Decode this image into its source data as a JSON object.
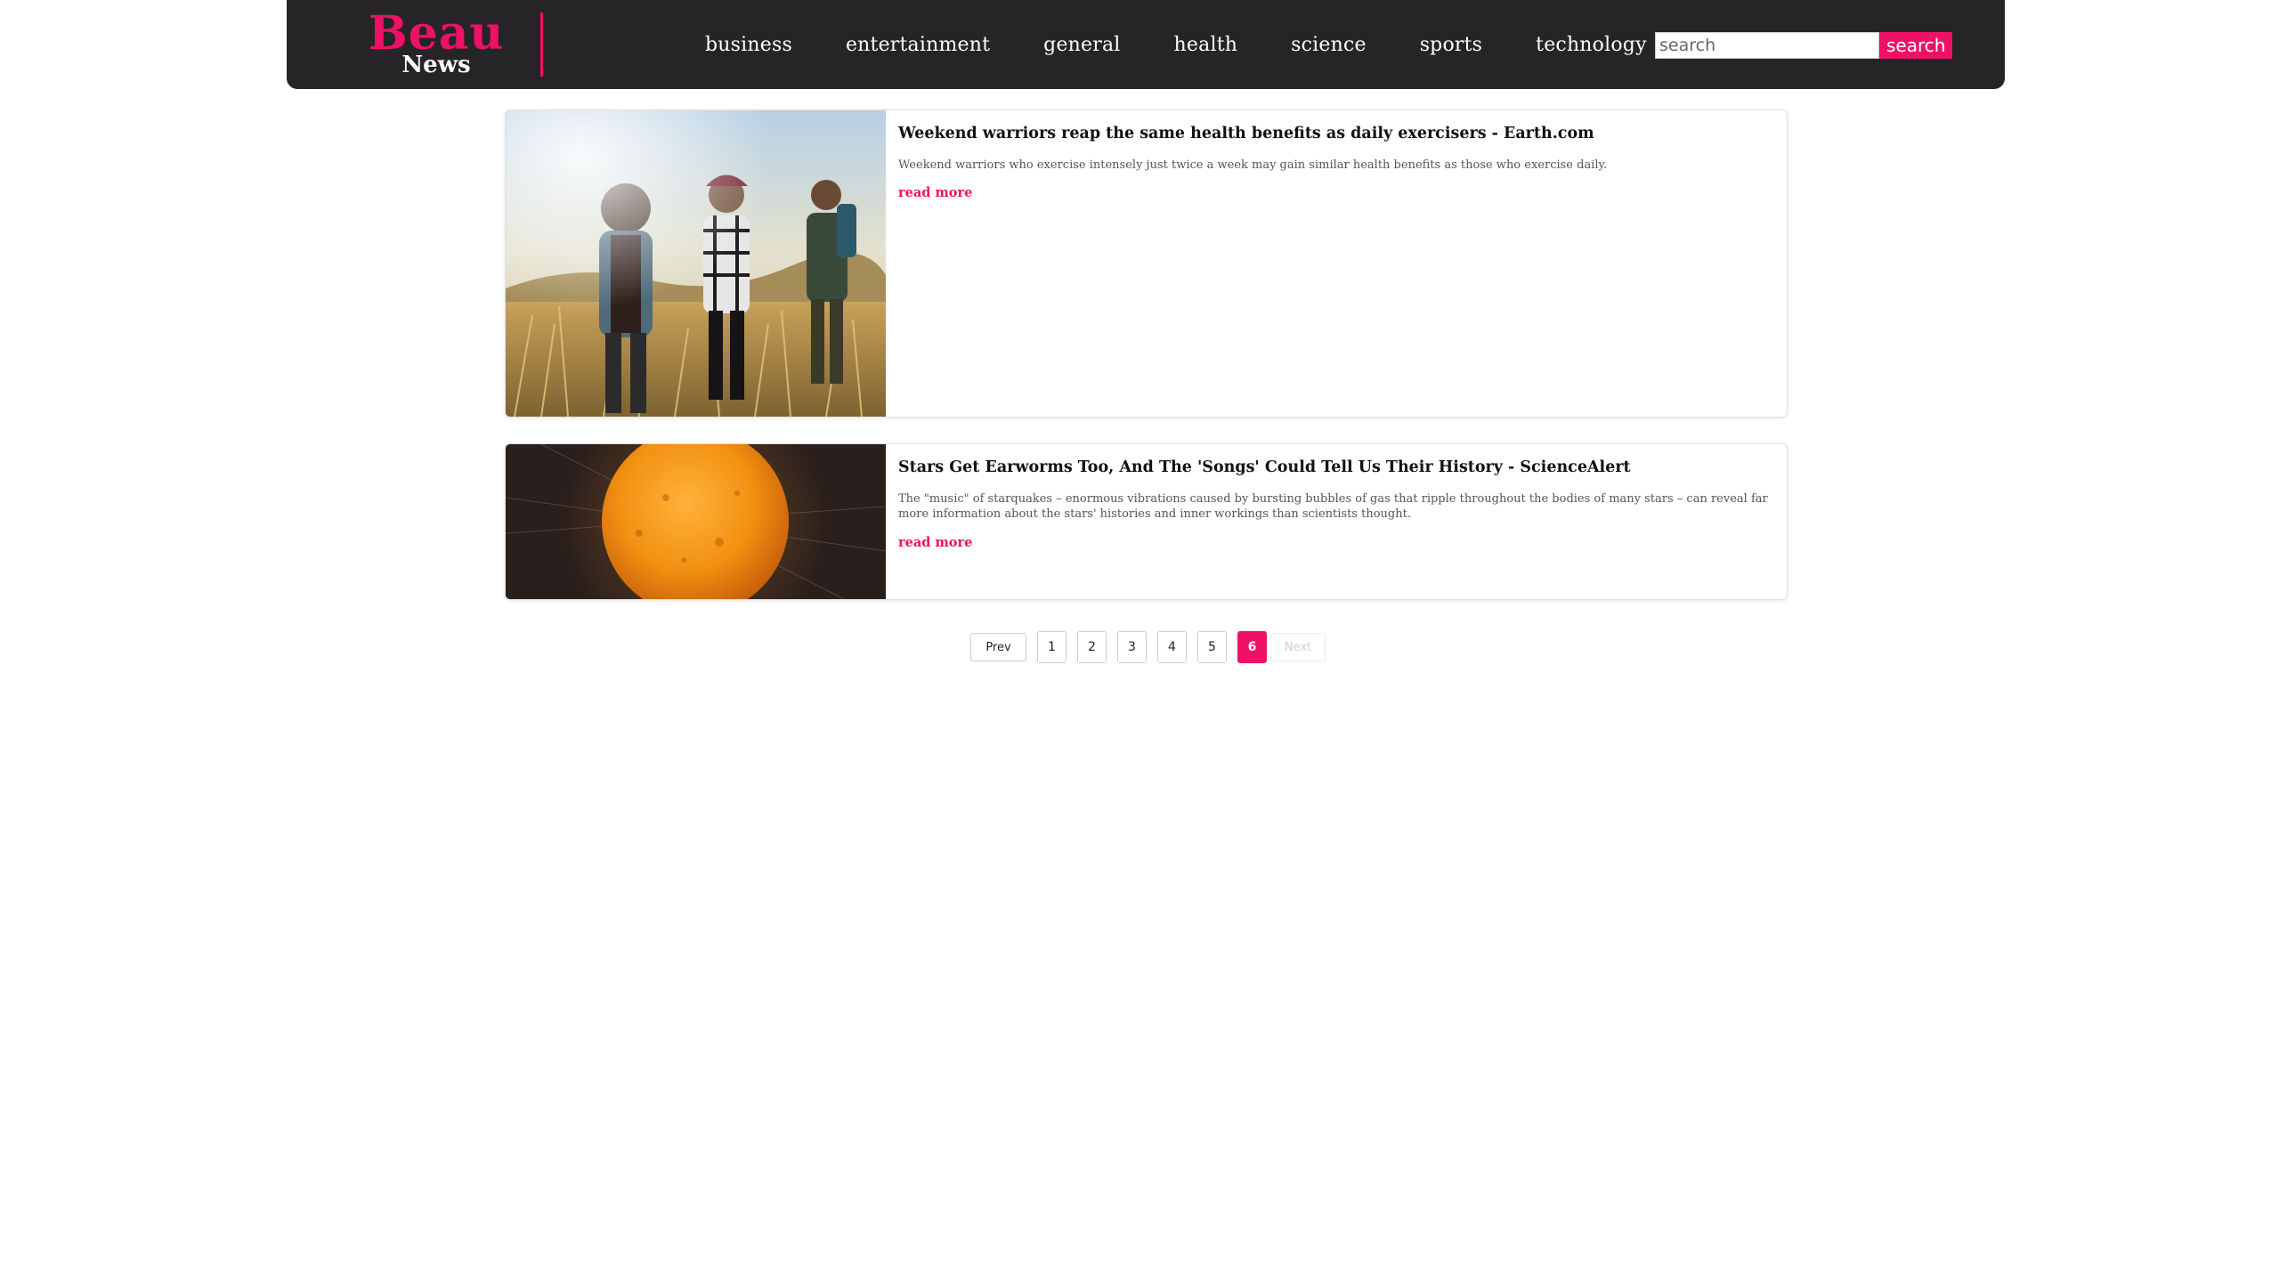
{
  "brand": {
    "name_top": "Beau",
    "name_bottom": "News",
    "accent_color": "#ee1166",
    "navbar_color": "#262426"
  },
  "nav": {
    "links": [
      "business",
      "entertainment",
      "general",
      "health",
      "science",
      "sports",
      "technology"
    ]
  },
  "search": {
    "placeholder": "search",
    "value": "",
    "button_label": "search"
  },
  "articles": [
    {
      "title": "Weekend warriors reap the same health benefits as daily exercisers - Earth.com",
      "description": "Weekend warriors who exercise intensely just twice a week may gain similar health benefits as those who exercise daily.",
      "read_more": "read more",
      "image": "hikers-walking-in-field"
    },
    {
      "title": "Stars Get Earworms Too, And The 'Songs' Could Tell Us Their History - ScienceAlert",
      "description": "The \"music\" of starquakes – enormous vibrations caused by bursting bubbles of gas that ripple throughout the bodies of many stars – can reveal far more information about the stars' histories and inner workings than scientists thought.",
      "read_more": "read more",
      "image": "glowing-orange-sun"
    }
  ],
  "pagination": {
    "prev_label": "Prev",
    "next_label": "Next",
    "pages": [
      "1",
      "2",
      "3",
      "4",
      "5",
      "6"
    ],
    "current_page": "6"
  }
}
